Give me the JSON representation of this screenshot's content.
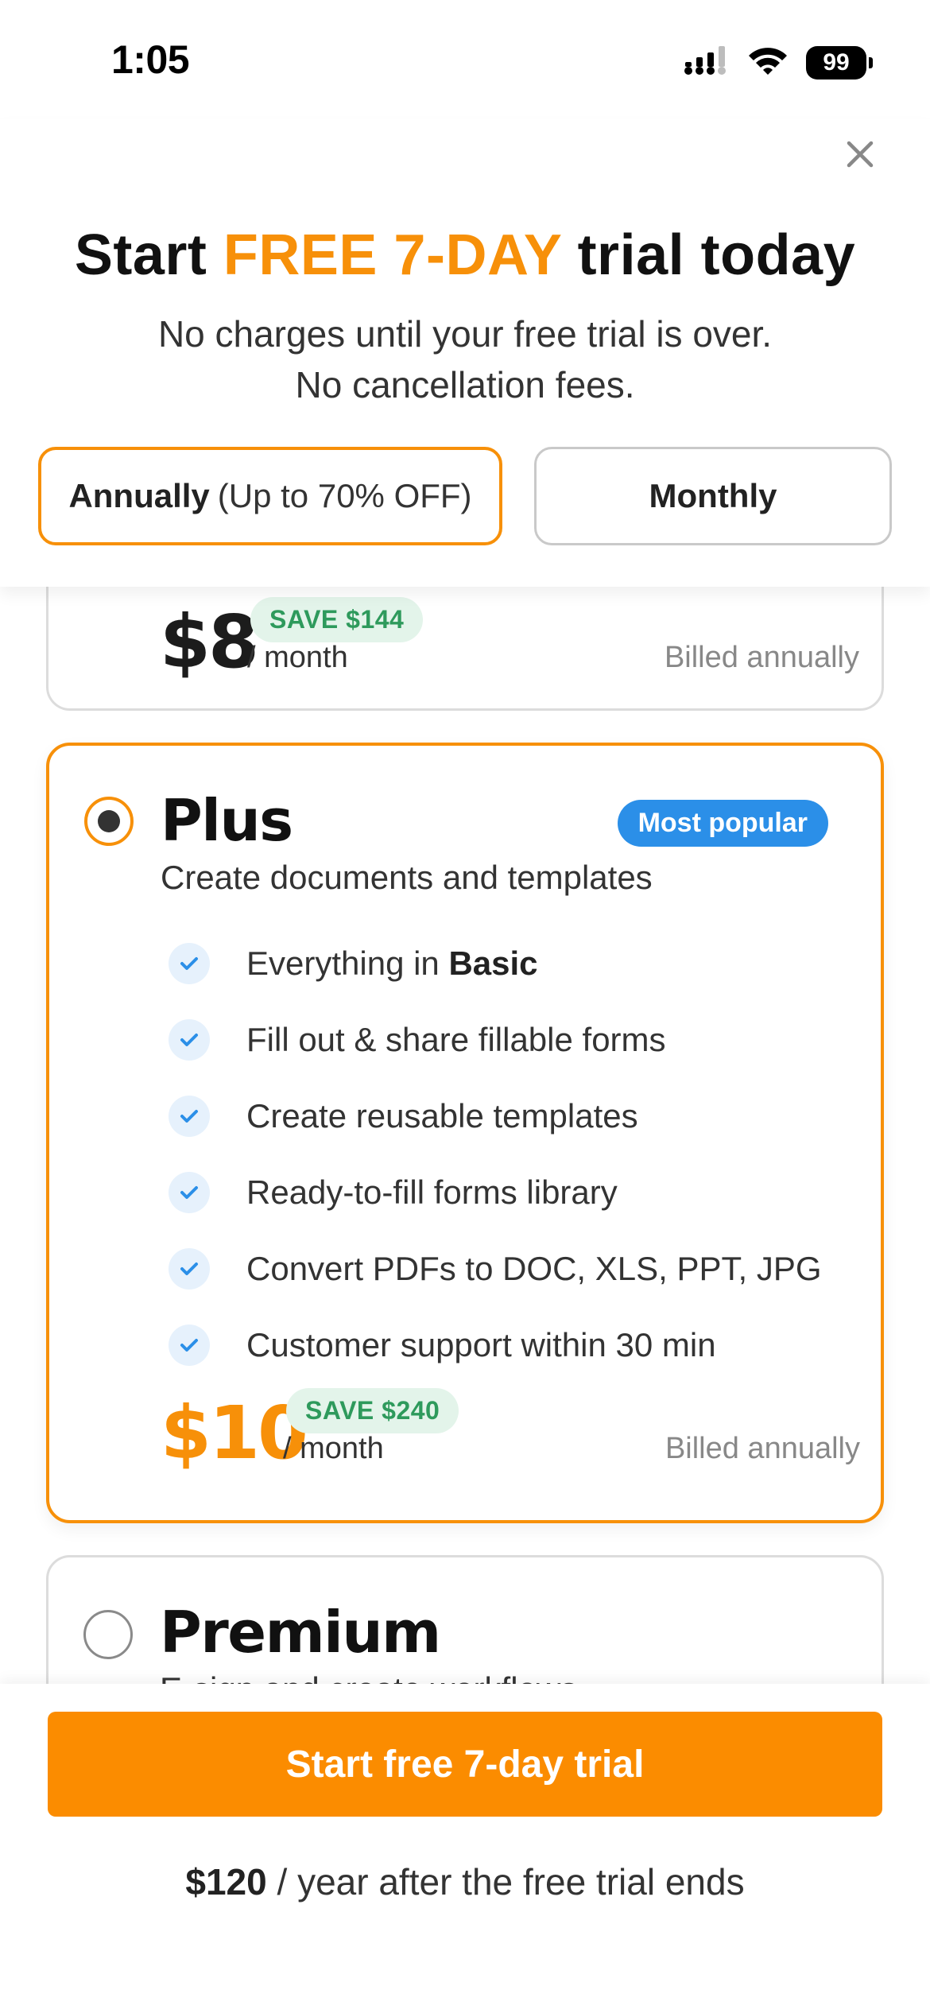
{
  "status_bar": {
    "time": "1:05",
    "battery": "99",
    "icons": [
      "signal-icon",
      "wifi-icon",
      "battery-icon"
    ]
  },
  "header": {
    "close_icon": "close-icon",
    "title_prefix": "Start ",
    "title_accent": "FREE 7-DAY",
    "title_suffix": " trial today",
    "subtitle_line1": "No charges until your free trial is over.",
    "subtitle_line2": "No cancellation fees.",
    "accent_color": "#f79009"
  },
  "billing_tabs": {
    "annual_label": "Annually",
    "annual_note": "(Up to 70% OFF)",
    "monthly_label": "Monthly",
    "selected": "annual"
  },
  "plans": {
    "basic": {
      "price": "$8",
      "per": "/ month",
      "save": "SAVE $144",
      "billed": "Billed annually"
    },
    "plus": {
      "name": "Plus",
      "description": "Create documents and templates",
      "badge": "Most popular",
      "selected": true,
      "features": [
        {
          "text": "Everything in ",
          "bold": "Basic"
        },
        {
          "text": "Fill out & share fillable forms",
          "bold": ""
        },
        {
          "text": "Create reusable templates",
          "bold": ""
        },
        {
          "text": "Ready-to-fill forms library",
          "bold": ""
        },
        {
          "text": "Convert PDFs to DOC, XLS, PPT, JPG",
          "bold": ""
        },
        {
          "text": "Customer support within 30 min",
          "bold": ""
        }
      ],
      "price": "$10",
      "per": "/ month",
      "save": "SAVE $240",
      "billed": "Billed annually"
    },
    "premium": {
      "name": "Premium",
      "description": "E-sign and create workflows"
    }
  },
  "footer": {
    "cta_label": "Start free 7-day trial",
    "price_after": "$120",
    "after_text": " / year after the free trial ends",
    "cta_color": "#fb8c00"
  }
}
